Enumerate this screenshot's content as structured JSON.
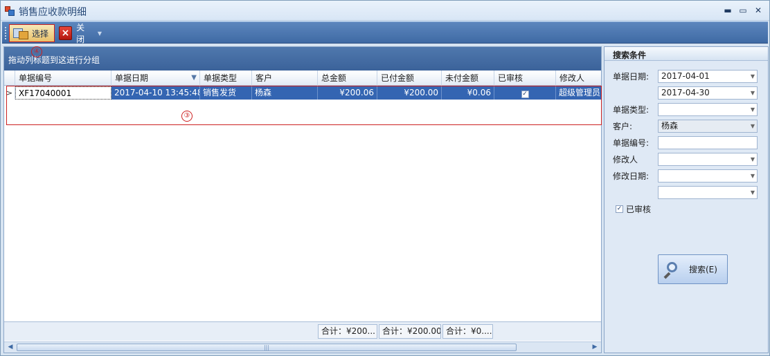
{
  "window": {
    "title": "销售应收款明细",
    "minimize": "▬",
    "maximize": "▭",
    "close": "✕"
  },
  "toolbar": {
    "select_label": "选择",
    "close_label": "关闭",
    "dropdown": "▼"
  },
  "markers": {
    "m4": "④",
    "m3": "③"
  },
  "grid": {
    "group_hint": "拖动列标题到这进行分组",
    "sort_indicator": "▼",
    "row_indicator": ">",
    "columns": [
      "单据编号",
      "单据日期",
      "单据类型",
      "客户",
      "总金额",
      "已付金额",
      "未付金额",
      "已审核",
      "修改人"
    ],
    "rows": [
      {
        "bill_no": "XF17040001",
        "bill_date": "2017-04-10 13:45:48",
        "bill_type": "销售发货",
        "customer": "杨森",
        "total": "¥200.06",
        "paid": "¥200.00",
        "unpaid": "¥0.06",
        "audited": true,
        "audited_mark": "✓",
        "modifier": "超级管理员"
      }
    ],
    "footer": {
      "total": "合计：¥200...",
      "paid": "合计：¥200.00",
      "unpaid": "合计：¥0...."
    },
    "scroll": {
      "left": "◀",
      "right": "▶",
      "thumb": "|||"
    }
  },
  "search": {
    "title": "搜索条件",
    "bill_date_label": "单据日期:",
    "date_from": "2017-04-01",
    "date_to": "2017-04-30",
    "bill_type_label": "单据类型:",
    "bill_type_value": "",
    "customer_label": "客户:",
    "customer_value": "杨森",
    "bill_no_label": "单据编号:",
    "bill_no_value": "",
    "modifier_label": "修改人",
    "modifier_value": "",
    "modify_date_label": "修改日期:",
    "modify_date_from": "",
    "modify_date_to": "",
    "audited_label": "已审核",
    "audited_checked": true,
    "audited_mark": "✓",
    "arrow": "▼",
    "button_label": "搜索(E)"
  }
}
